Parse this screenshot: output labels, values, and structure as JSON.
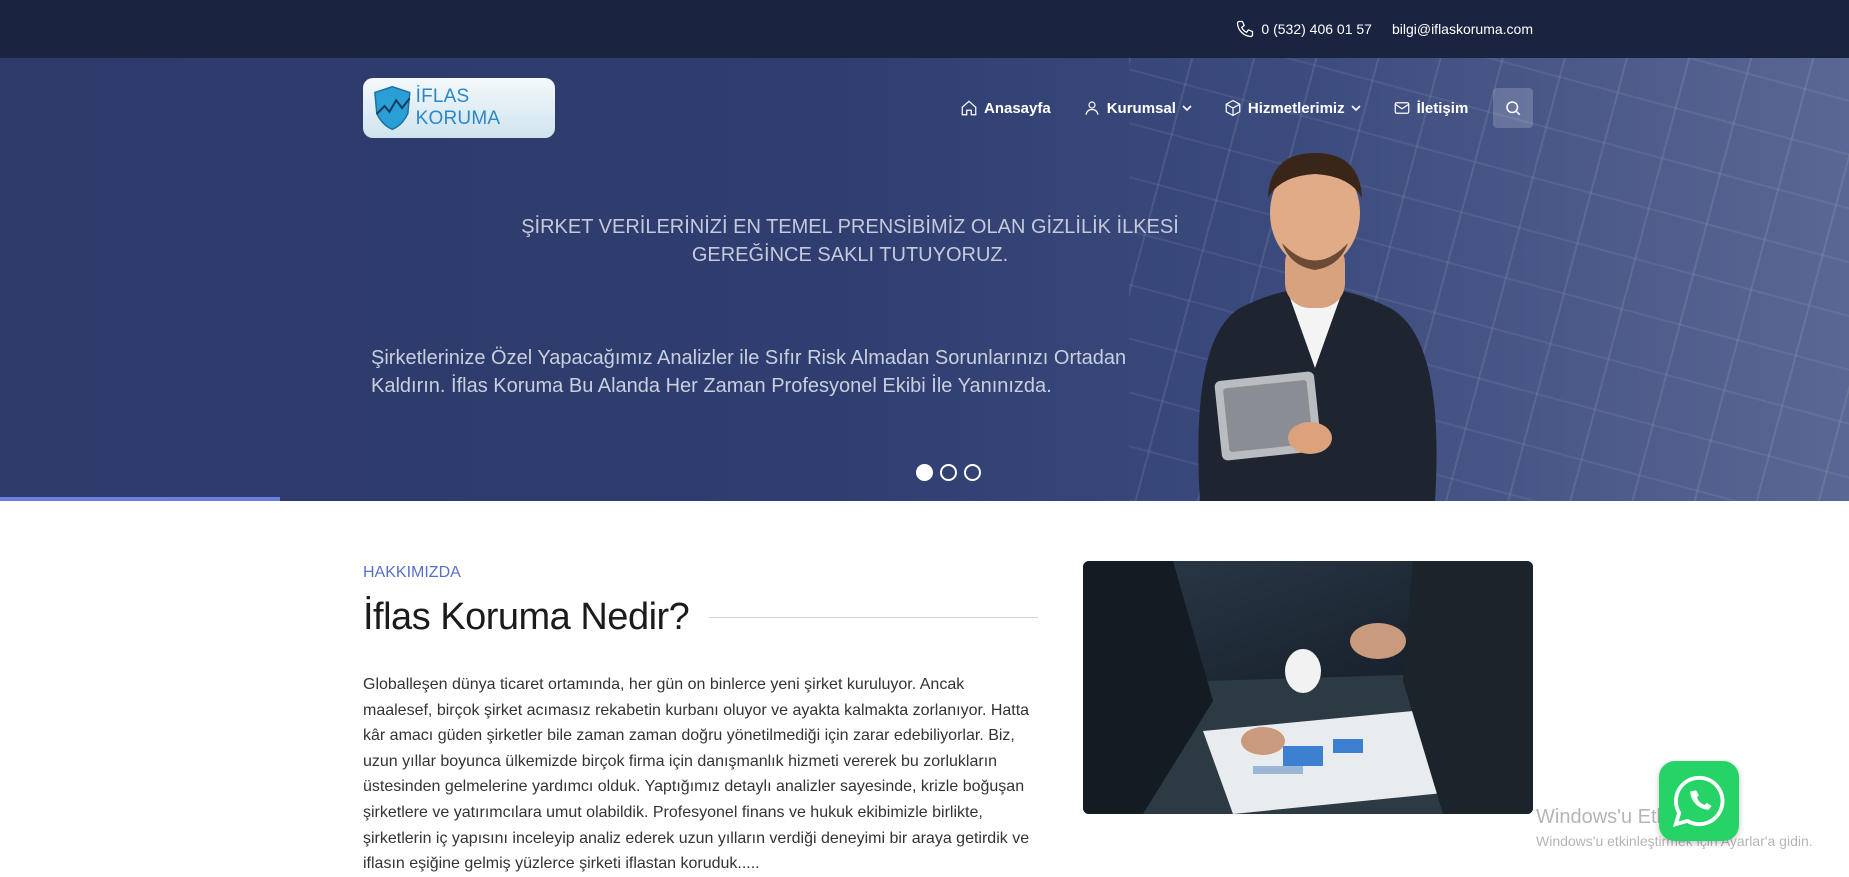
{
  "topbar": {
    "phone": "0 (532) 406 01 57",
    "email": "bilgi@iflaskoruma.com"
  },
  "logo": {
    "text": "İFLAS KORUMA"
  },
  "nav": {
    "items": [
      {
        "label": "Anasayfa",
        "icon": "home-icon"
      },
      {
        "label": "Kurumsal",
        "icon": "user-icon",
        "has_dropdown": true
      },
      {
        "label": "Hizmetlerimiz",
        "icon": "box-icon",
        "has_dropdown": true
      },
      {
        "label": "İletişim",
        "icon": "mail-icon"
      }
    ],
    "search_icon": "search-icon"
  },
  "hero": {
    "headline": "ŞİRKET VERİLERİNİZİ EN TEMEL PRENSİBİMİZ OLAN GİZLİLİK İLKESİ GEREĞİNCE SAKLI TUTUYORUZ.",
    "subline": "Şirketlerinize Özel Yapacağımız Analizler ile Sıfır Risk Almadan Sorunlarınızı Ortadan Kaldırın. İflas Koruma Bu Alanda Her Zaman Profesyonel Ekibi İle Yanınızda.",
    "slide_count": 3,
    "active_slide": 1
  },
  "about": {
    "eyebrow": "HAKKIMIZDA",
    "title": "İflas Koruma Nedir?",
    "paragraph": "Globalleşen dünya ticaret ortamında, her gün on binlerce yeni şirket kuruluyor. Ancak maalesef, birçok şirket acımasız rekabetin kurbanı oluyor ve ayakta kalmakta zorlanıyor. Hatta kâr amacı güden şirketler bile zaman zaman doğru yönetilmediği için zarar edebiliyorlar. Biz, uzun yıllar boyunca ülkemizde birçok firma için danışmanlık hizmeti vererek bu zorlukların üstesinden gelmelerine yardımcı olduk. Yaptığımız detaylı analizler sayesinde, krizle boğuşan şirketlere ve yatırımcılara umut olabildik. Profesyonel finans ve hukuk ekibimizle birlikte, şirketlerin iç yapısını inceleyip analiz ederek uzun yılların verdiği deneyimi bir araya getirdik ve iflasın eşiğine gelmiş yüzlerce şirketi iflastan koruduk....."
  },
  "watermark": {
    "line1": "Windows'u Etkinleştir",
    "line2": "Windows'u etkinleştirmek için Ayarlar'a gidin."
  },
  "colors": {
    "topbar": "#1a2340",
    "hero": "#2f3d70",
    "accent": "#5a6fc8",
    "whatsapp": "#25d366"
  }
}
